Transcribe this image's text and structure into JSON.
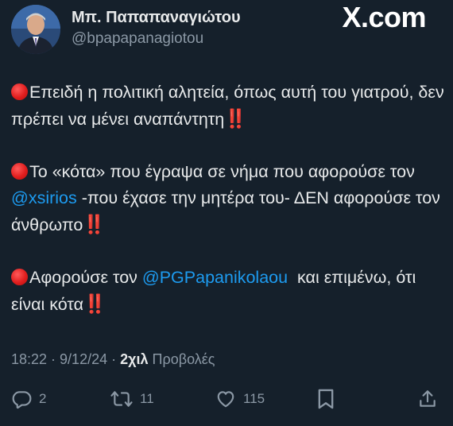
{
  "author": {
    "display_name": "Μπ. Παπαπαναγιώτου",
    "handle": "@bpapapanagiotou",
    "avatar_icon": "avatar-photo"
  },
  "watermark": "X.com",
  "tweet": {
    "para1": {
      "text1": "Επειδή η πολιτική αλητεία, όπως αυτή του γιατρού, δεν πρέπει να μένει αναπάντητη",
      "bang": "‼️"
    },
    "para2": {
      "text1": "Το «κότα» που έγραψα σε νήμα που αφορούσε τον ",
      "mention": "@xsirios",
      "text2": " -που έχασε την μητέρα του- ΔΕΝ αφορούσε τον άνθρωπο",
      "bang": "‼️"
    },
    "para3": {
      "text1": "Αφορούσε τον ",
      "mention": "@PGPapanikolaou",
      "text2": "  και επιμένω, ότι είναι κότα",
      "bang": "‼️"
    }
  },
  "meta": {
    "time": "18:22",
    "sep1": " · ",
    "date": "9/12/24",
    "sep2": " · ",
    "views_count": "2χιλ",
    "views_label": " Προβολές"
  },
  "actions": {
    "replies": "2",
    "retweets": "11",
    "likes": "115"
  },
  "colors": {
    "background": "#15202b",
    "text": "#e7e9ea",
    "muted": "#8b98a5",
    "link": "#1d9bf0",
    "alert": "#f21d2f"
  }
}
